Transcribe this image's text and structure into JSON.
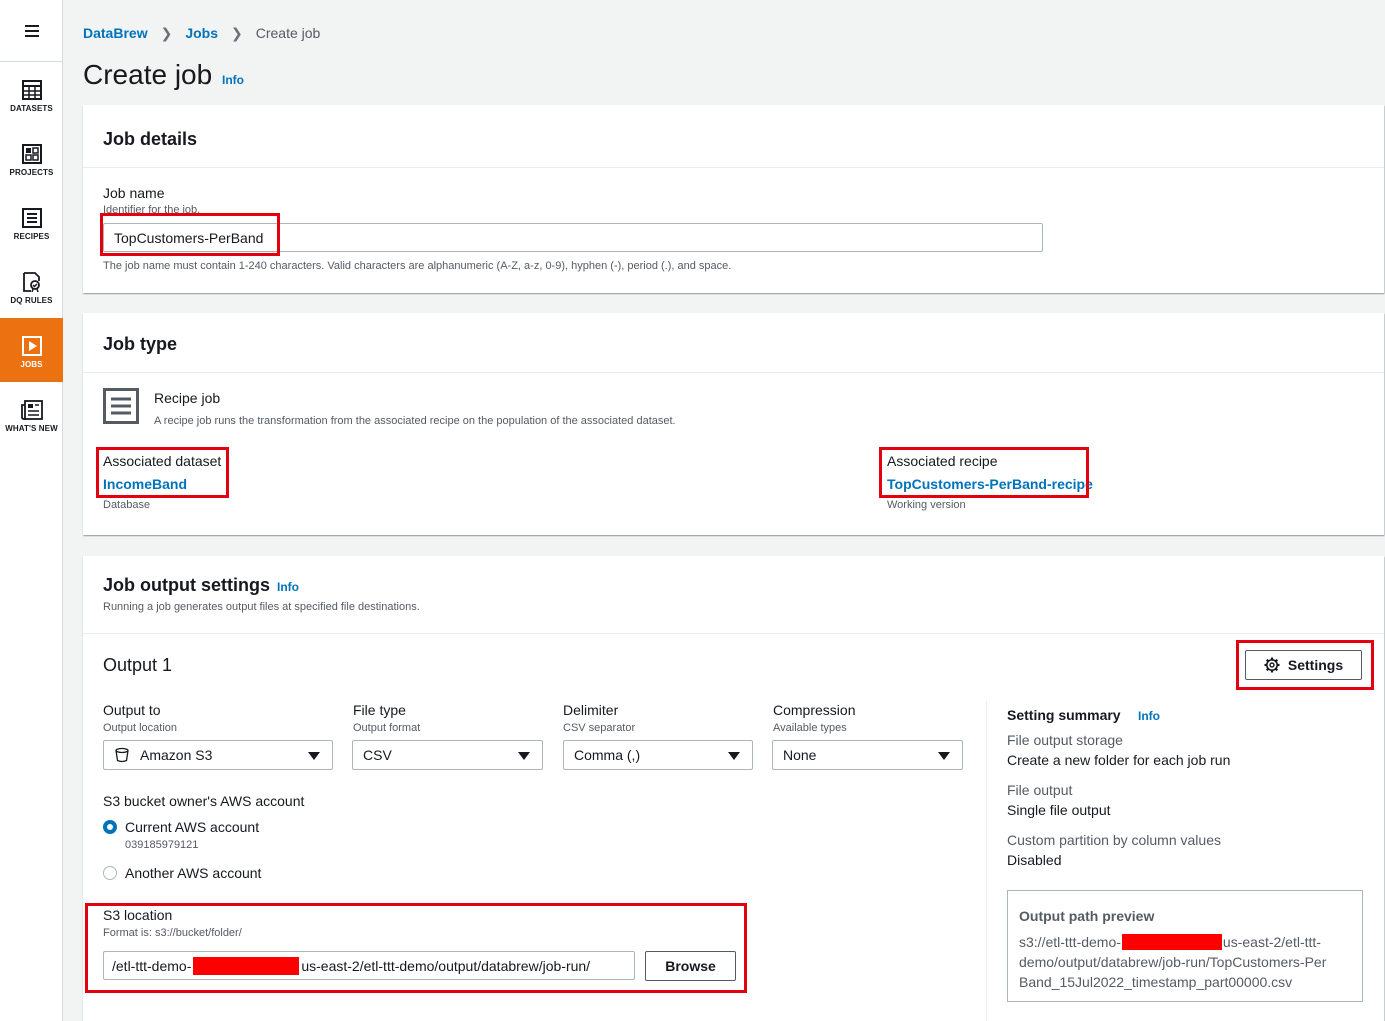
{
  "breadcrumb": {
    "root": "DataBrew",
    "jobs": "Jobs",
    "current": "Create job"
  },
  "page": {
    "title": "Create job",
    "info": "Info"
  },
  "sidebar": {
    "items": [
      {
        "label": "DATASETS",
        "icon": "table-grid-icon"
      },
      {
        "label": "PROJECTS",
        "icon": "project-grid-icon"
      },
      {
        "label": "RECIPES",
        "icon": "recipe-list-icon"
      },
      {
        "label": "DQ RULES",
        "icon": "dq-rules-icon"
      },
      {
        "label": "JOBS",
        "icon": "play-icon"
      },
      {
        "label": "WHAT'S NEW",
        "icon": "newspaper-icon"
      }
    ]
  },
  "job_details": {
    "title": "Job details",
    "job_name_label": "Job name",
    "job_name_desc": "Identifier for the job.",
    "job_name_value": "TopCustomers-PerBand",
    "job_name_hint": "The job name must contain 1-240 characters. Valid characters are alphanumeric (A-Z, a-z, 0-9), hyphen (-), period (.), and space."
  },
  "job_type": {
    "title": "Job type",
    "type_label": "Recipe job",
    "type_desc": "A recipe job runs the transformation from the associated recipe on the population of the associated dataset.",
    "dataset_label": "Associated dataset",
    "dataset_value": "IncomeBand",
    "dataset_sub": "Database",
    "recipe_label": "Associated recipe",
    "recipe_value": "TopCustomers-PerBand-recipe",
    "recipe_sub": "Working version"
  },
  "output_settings": {
    "title": "Job output settings",
    "info": "Info",
    "desc": "Running a job generates output files at specified file destinations.",
    "output_title": "Output 1",
    "settings_button": "Settings",
    "output_to": {
      "label": "Output to",
      "desc": "Output location",
      "value": "Amazon S3"
    },
    "file_type": {
      "label": "File type",
      "desc": "Output format",
      "value": "CSV"
    },
    "delimiter": {
      "label": "Delimiter",
      "desc": "CSV separator",
      "value": "Comma (,)"
    },
    "compression": {
      "label": "Compression",
      "desc": "Available types",
      "value": "None"
    },
    "bucket_owner_label": "S3 bucket owner's AWS account",
    "current_account": "Current AWS account",
    "account_id": "039185979121",
    "another_account": "Another AWS account",
    "s3_location_label": "S3 location",
    "s3_location_format": "Format is: s3://bucket/folder/",
    "s3_location_prefix": "/etl-ttt-demo-",
    "s3_location_suffix": "us-east-2/etl-ttt-demo/output/databrew/job-run/",
    "browse_button": "Browse",
    "summary": {
      "title": "Setting summary",
      "info": "Info",
      "storage_label": "File output storage",
      "storage_value": "Create a new folder for each job run",
      "file_output_label": "File output",
      "file_output_value": "Single file output",
      "partition_label": "Custom partition by column values",
      "partition_value": "Disabled"
    },
    "preview": {
      "title": "Output path preview",
      "line1_prefix": "s3://etl-ttt-demo-",
      "line1_suffix": "us-east-2/etl-ttt-",
      "line2": "demo/output/databrew/job-run/TopCustomers-Per",
      "line3": "Band_15Jul2022_timestamp_part00000.csv"
    }
  },
  "colors": {
    "accent": "#ec7211",
    "link": "#0073bb",
    "highlight": "#e3000f"
  }
}
